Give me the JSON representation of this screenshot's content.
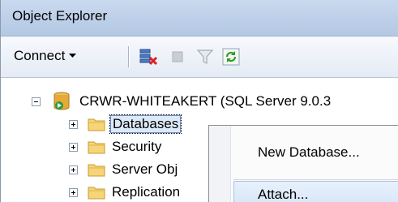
{
  "panel": {
    "title": "Object Explorer"
  },
  "toolbar": {
    "connect_label": "Connect",
    "icons": [
      "disconnect-icon",
      "stop-icon",
      "filter-icon",
      "refresh-icon"
    ]
  },
  "tree": {
    "server": {
      "label": "CRWR-WHITEAKERT (SQL Server 9.0.3"
    },
    "items": [
      {
        "label": "Databases",
        "selected": true
      },
      {
        "label": "Security"
      },
      {
        "label": "Server Obj"
      },
      {
        "label": "Replication"
      }
    ]
  },
  "context_menu": {
    "items": [
      {
        "label": "New Database..."
      },
      {
        "label": "Attach...",
        "hover": true
      }
    ]
  },
  "colors": {
    "title_gradient": "#c9d9ee",
    "selection": "#dde9f8",
    "menu_hover": "#d5e5f8"
  }
}
